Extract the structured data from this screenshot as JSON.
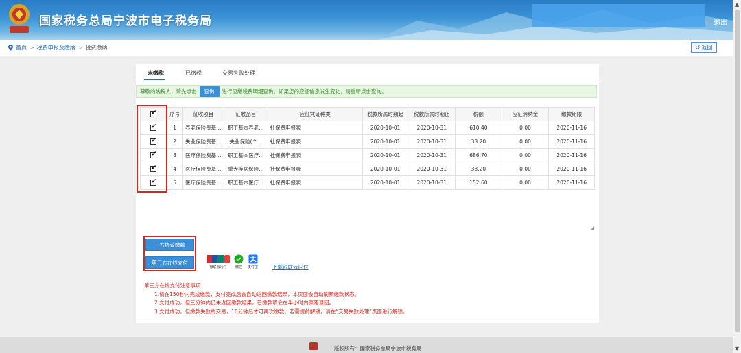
{
  "header": {
    "site_title": "国家税务总局宁波市电子税务局",
    "logout": "退出",
    "divider": "|"
  },
  "breadcrumb": {
    "home": "首页",
    "level1": "税费申报及缴纳",
    "level2": "税费缴纳",
    "sep": ">",
    "back": "返回"
  },
  "tabs": [
    "未缴税",
    "已缴税",
    "交易失败处理"
  ],
  "notice": {
    "prefix": "尊敬的纳税人，请先点击",
    "button": "查询",
    "suffix": "进行应缴税费明细查询。如果您的应征信息发生变化，请重新点击查询。"
  },
  "table": {
    "headers": [
      "序号",
      "征收项目",
      "征收品目",
      "应征凭证种类",
      "税款所属时期起",
      "税款所属时期止",
      "税额",
      "应征滞纳金",
      "缴款期限"
    ],
    "rows": [
      {
        "no": "1",
        "item": "养老保险费基...",
        "subitem": "职工基本养老...",
        "voucher": "社保费申报表",
        "start": "2020-10-01",
        "end": "2020-10-31",
        "amount": "610.40",
        "late_fee": "0.00",
        "deadline": "2020-11-16",
        "checked": true
      },
      {
        "no": "2",
        "item": "失业保险费基...",
        "subitem": "失业保险(个...",
        "voucher": "社保费申报表",
        "start": "2020-10-01",
        "end": "2020-10-31",
        "amount": "38.20",
        "late_fee": "0.00",
        "deadline": "2020-11-16",
        "checked": true
      },
      {
        "no": "3",
        "item": "医疗保险费基...",
        "subitem": "职工基本医疗...",
        "voucher": "社保费申报表",
        "start": "2020-10-01",
        "end": "2020-10-31",
        "amount": "686.70",
        "late_fee": "0.00",
        "deadline": "2020-11-16",
        "checked": true
      },
      {
        "no": "4",
        "item": "医疗保险费基...",
        "subitem": "重大疾病保险...",
        "voucher": "社保费申报表",
        "start": "2020-10-01",
        "end": "2020-10-31",
        "amount": "38.20",
        "late_fee": "0.00",
        "deadline": "2020-11-16",
        "checked": true
      },
      {
        "no": "5",
        "item": "医疗保险费基...",
        "subitem": "职工基本医疗...",
        "voucher": "社保费申报表",
        "start": "2020-10-01",
        "end": "2020-10-31",
        "amount": "152.60",
        "late_fee": "0.00",
        "deadline": "2020-11-16",
        "checked": true
      }
    ]
  },
  "payment": {
    "agreement_button": "三方协议缴款",
    "online_button": "第三方在线支付",
    "methods": [
      "银联云闪付",
      "微信",
      "支付宝"
    ],
    "download_link": "下载银联云闪付"
  },
  "notes": {
    "title": "第三方在线支付注意事项：",
    "items": [
      "1.请在150秒内完成缴款，支付完成后会自动返回缴款结果，本页面会自动刷新缴款状态。",
      "2.支付成功，但三分钟内仍未返回缴款结果，已缴款项会在半小时内原路退回。",
      "3.支付成功，但缴款失败的交易，10分钟后才可再次缴款。若需提前解锁，请在“交易失败处理”页面进行解锁。"
    ]
  },
  "footer": {
    "copyright": "版权所有：国家税务总局宁波市税务局"
  },
  "colors": {
    "header_blue": "#2a7cc4",
    "button_blue": "#3a8fd8",
    "highlight_red": "#e3231a",
    "notice_green": "#3d8a2e"
  }
}
